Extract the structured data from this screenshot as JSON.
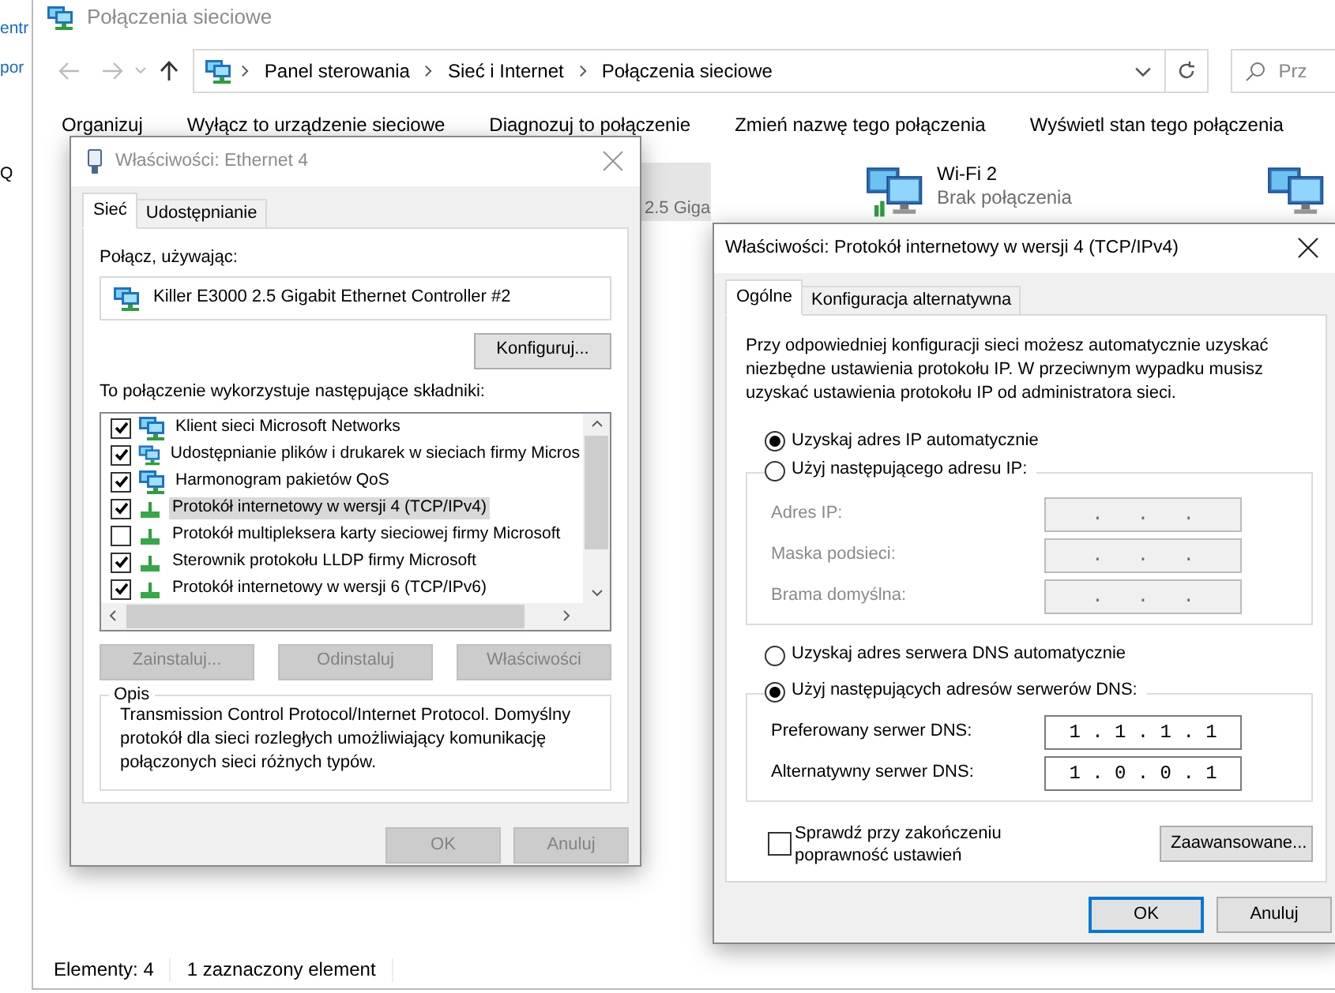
{
  "desktop_edge": {
    "texts": [
      "entr",
      "por",
      "Q"
    ]
  },
  "explorer": {
    "title": "Połączenia sieciowe",
    "breadcrumb": [
      "Panel sterowania",
      "Sieć i Internet",
      "Połączenia sieciowe"
    ],
    "search": {
      "placeholder": "Prz"
    },
    "toolbar": [
      "Organizuj",
      "Wyłącz to urządzenie sieciowe",
      "Diagnozuj to połączenie",
      "Zmień nazwę tego połączenia",
      "Wyświetl stan tego połączenia"
    ],
    "connections": [
      {
        "kind": "partial",
        "detail": "2.5 Giga",
        "selected": true
      },
      {
        "kind": "full",
        "name": "Wi-Fi 2",
        "status": "Brak połączenia",
        "selected": false
      },
      {
        "kind": "icon",
        "selected": false
      }
    ],
    "status_bar": [
      "Elementy: 4",
      "1 zaznaczony element"
    ]
  },
  "ethernet_dialog": {
    "title": "Właściwości: Ethernet 4",
    "tabs": [
      {
        "label": "Sieć",
        "selected": true
      },
      {
        "label": "Udostępnianie",
        "selected": false
      }
    ],
    "connect_label": "Połącz, używając:",
    "adapter": "Killer E3000 2.5 Gigabit Ethernet Controller #2",
    "configure_button": "Konfiguruj...",
    "components_label": "To połączenie wykorzystuje następujące składniki:",
    "components": [
      {
        "kind": "client",
        "label": "Klient sieci Microsoft Networks",
        "checked": true,
        "selected": false
      },
      {
        "kind": "service",
        "label": "Udostępnianie plików i drukarek w sieciach firmy Micros",
        "checked": true,
        "selected": false
      },
      {
        "kind": "service",
        "label": "Harmonogram pakietów QoS",
        "checked": true,
        "selected": false
      },
      {
        "kind": "protocol",
        "label": "Protokół internetowy w wersji 4 (TCP/IPv4)",
        "checked": true,
        "selected": true
      },
      {
        "kind": "protocol",
        "label": "Protokół multipleksera karty sieciowej firmy Microsoft",
        "checked": false,
        "selected": false
      },
      {
        "kind": "protocol",
        "label": "Sterownik protokołu LLDP firmy Microsoft",
        "checked": true,
        "selected": false
      },
      {
        "kind": "protocol",
        "label": "Protokół internetowy w wersji 6 (TCP/IPv6)",
        "checked": true,
        "selected": false
      }
    ],
    "component_buttons": [
      {
        "label": "Zainstaluj...",
        "disabled": true
      },
      {
        "label": "Odinstaluj",
        "disabled": true
      },
      {
        "label": "Właściwości",
        "disabled": true
      }
    ],
    "description": {
      "legend": "Opis",
      "text": "Transmission Control Protocol/Internet Protocol. Domyślny protokół dla sieci rozległych umożliwiający komunikację połączonych sieci różnych typów."
    },
    "buttons": [
      {
        "label": "OK",
        "disabled": true
      },
      {
        "label": "Anuluj",
        "disabled": true
      }
    ]
  },
  "ipv4_dialog": {
    "title": "Właściwości: Protokół internetowy w wersji 4 (TCP/IPv4)",
    "tabs": [
      {
        "label": "Ogólne",
        "selected": true
      },
      {
        "label": "Konfiguracja alternatywna",
        "selected": false
      }
    ],
    "intro": "Przy odpowiedniej konfiguracji sieci możesz automatycznie uzyskać niezbędne ustawienia protokołu IP. W przeciwnym wypadku musisz uzyskać ustawienia protokołu IP od administratora sieci.",
    "ip_radios": [
      {
        "label": "Uzyskaj adres IP automatycznie",
        "selected": true
      },
      {
        "label": "Użyj następującego adresu IP:",
        "selected": false
      }
    ],
    "ip_fields": [
      {
        "label": "Adres IP:",
        "value": ".   .   .",
        "disabled": true
      },
      {
        "label": "Maska podsieci:",
        "value": ".   .   .",
        "disabled": true
      },
      {
        "label": "Brama domyślna:",
        "value": ".   .   .",
        "disabled": true
      }
    ],
    "dns_radios": [
      {
        "label": "Uzyskaj adres serwera DNS automatycznie",
        "selected": false
      },
      {
        "label": "Użyj następujących adresów serwerów DNS:",
        "selected": true
      }
    ],
    "dns_fields": [
      {
        "label": "Preferowany serwer DNS:",
        "value": "1 . 1 . 1 . 1",
        "disabled": false
      },
      {
        "label": "Alternatywny serwer DNS:",
        "value": "1 . 0 . 0 . 1",
        "disabled": false
      }
    ],
    "validate": {
      "label": "Sprawdź przy zakończeniu poprawność ustawień",
      "checked": false
    },
    "advanced_button": "Zaawansowane...",
    "buttons": [
      {
        "label": "OK",
        "default": true
      },
      {
        "label": "Anuluj",
        "default": false
      }
    ]
  }
}
